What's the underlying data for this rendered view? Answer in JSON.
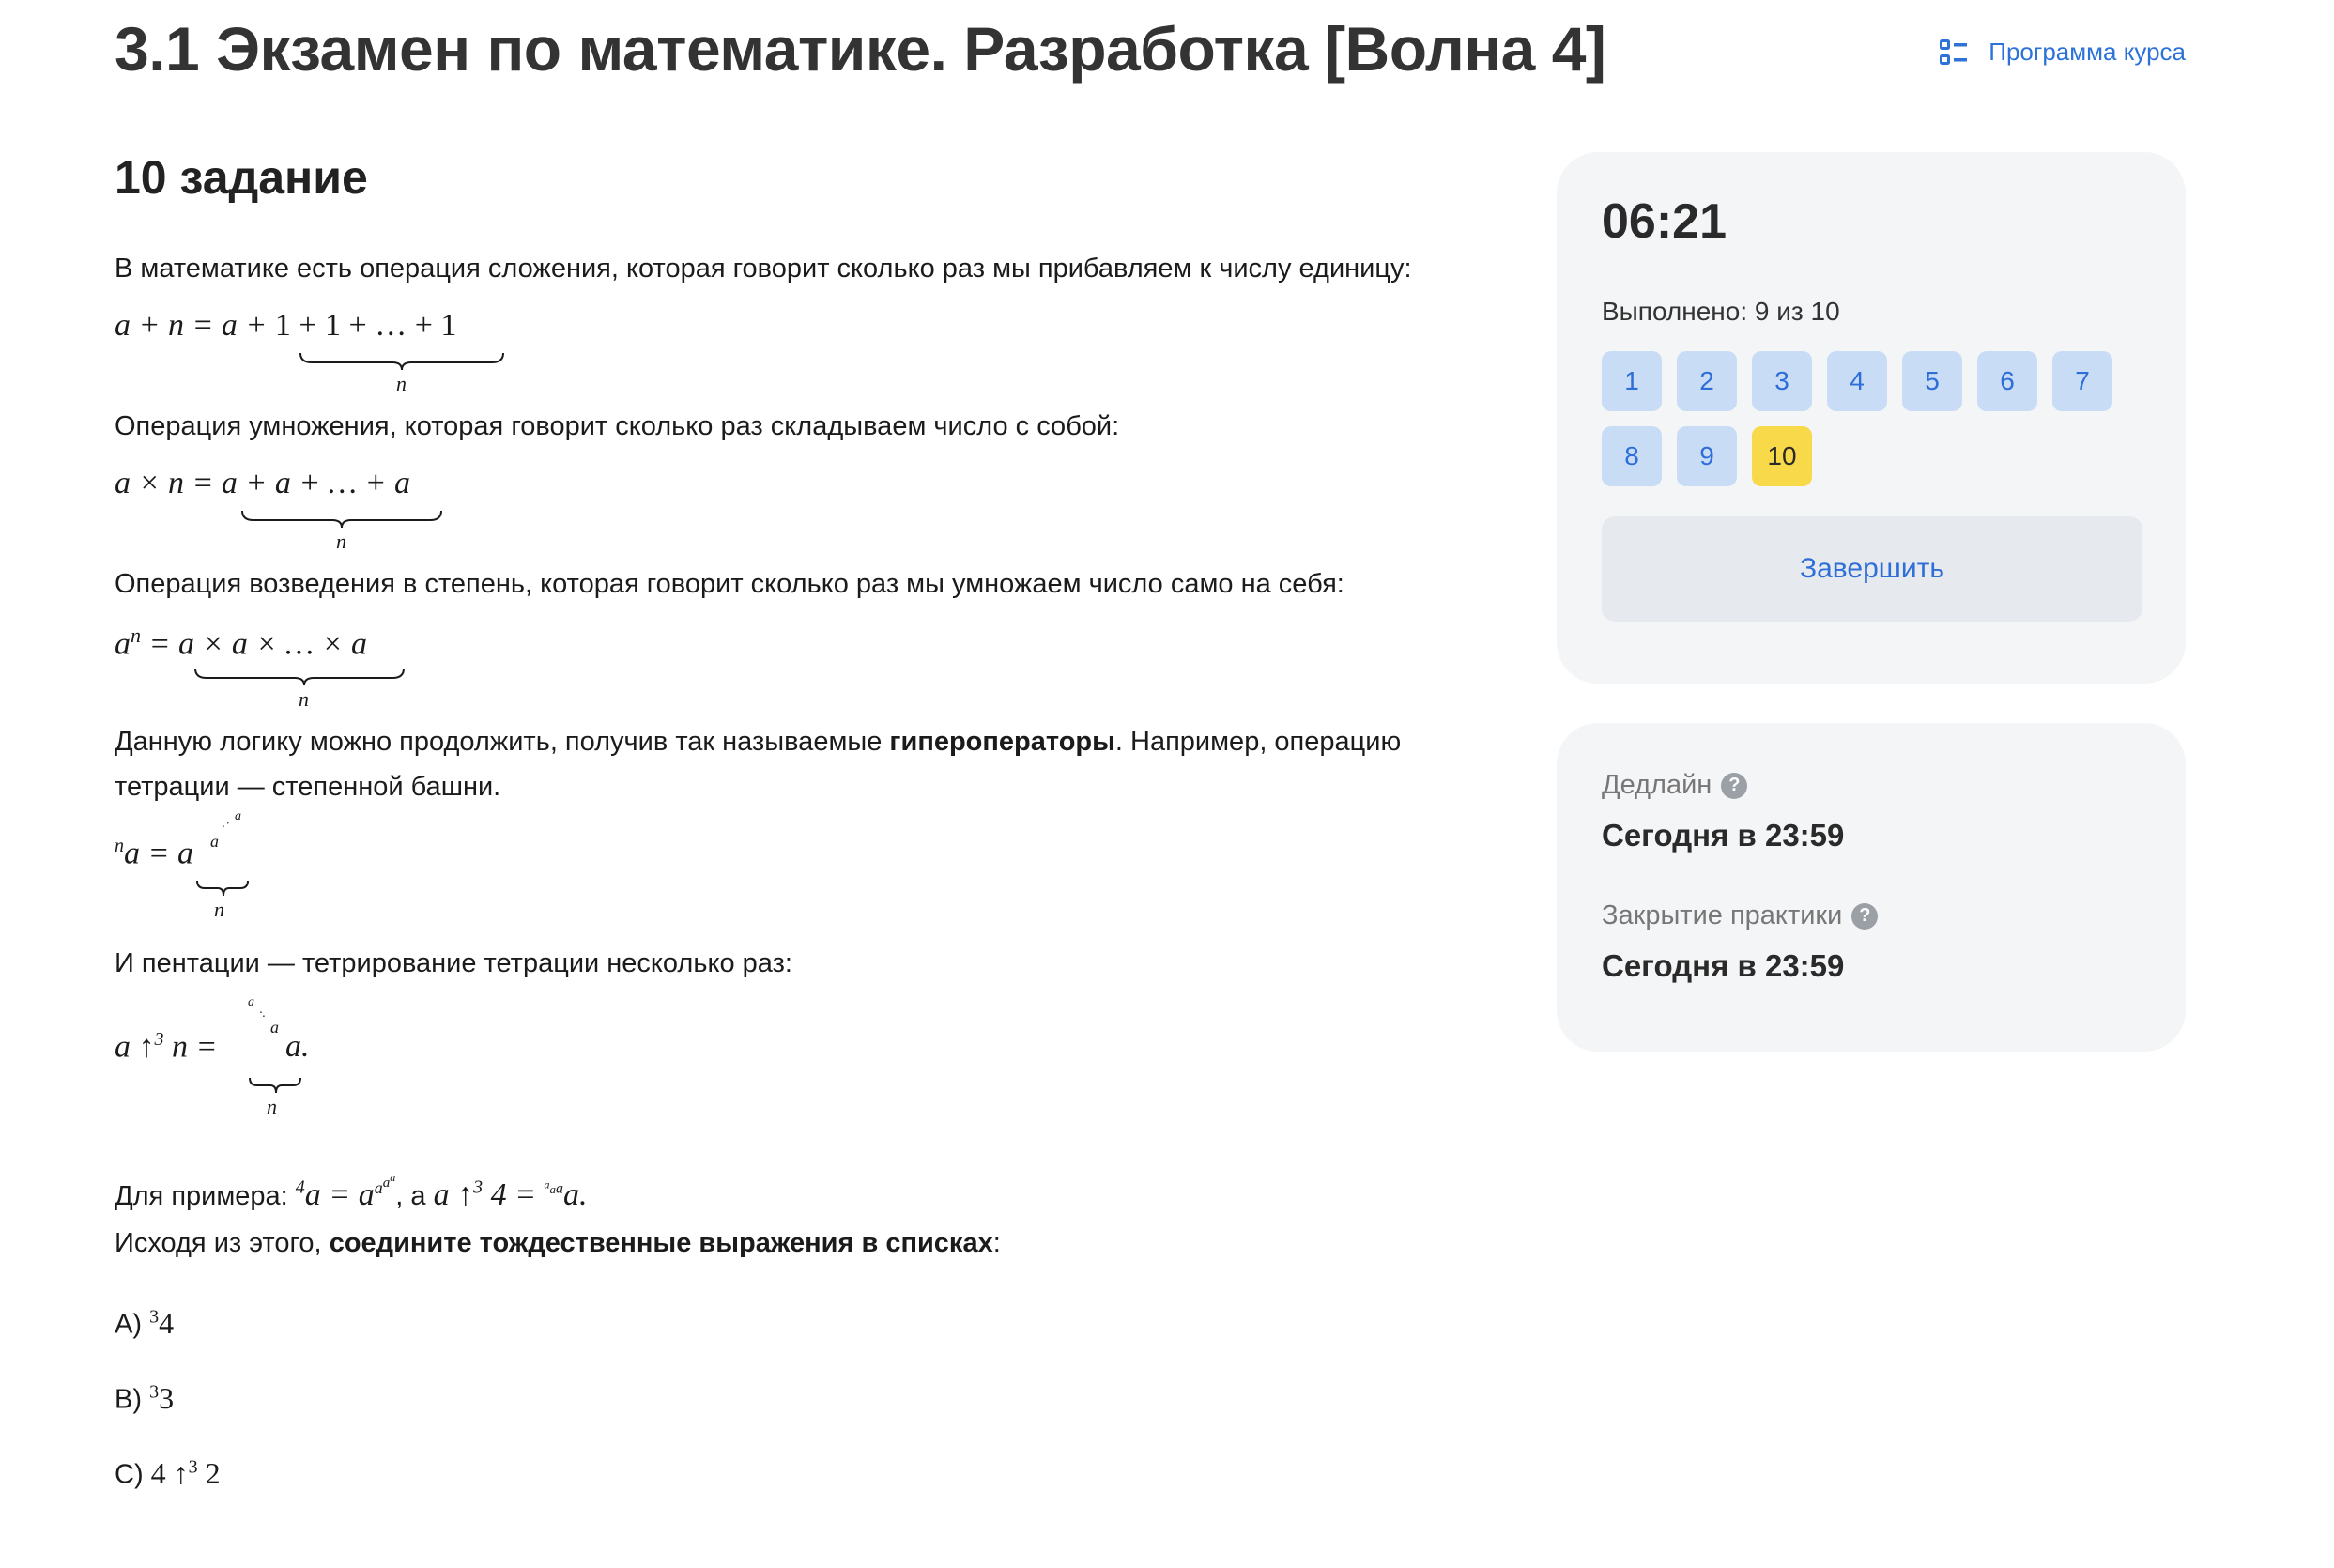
{
  "header": {
    "title": "3.1 Экзамен по математике. Разработка [Волна 4]",
    "program_link": "Программа курса"
  },
  "task": {
    "title": "10 задание",
    "p1": "В математике есть операция сложения, которая говорит сколько раз мы прибавляем к числу единицу:",
    "p2": "Операция умножения, которая говорит сколько раз складываем число с собой:",
    "p3": "Операция возведения в степень, которая говорит сколько раз мы умножаем число само на себя:",
    "p4_before": "Данную логику можно продолжить, получив так называемые ",
    "p4_bold": "гипероператоры",
    "p4_after": ". Например, операцию тетрации — степенной башни.",
    "p5": "И пентации — тетрирование тетрации несколько раз:",
    "example_prefix": "Для примера: ",
    "example_mid": ", а ",
    "p6_before": "Исходя из этого, ",
    "p6_bold": "соедините тождественные выражения в списках",
    "p6_after": ":",
    "answers": [
      {
        "label": "A)",
        "expr_sup": "3",
        "expr_base": "4"
      },
      {
        "label": "B)",
        "expr_sup": "3",
        "expr_base": "3"
      },
      {
        "label": "C)",
        "expr_left": "4 ↑",
        "expr_sup": "3",
        "expr_right": "2"
      }
    ]
  },
  "formulas": {
    "f1_lhs": "a + n = a + ",
    "f1_under": "1 + 1 + … + 1",
    "f1_brace": "n",
    "f2_lhs": "a × n = ",
    "f2_under": "a + a + … + a",
    "f2_brace": "n",
    "f3_lhs_base": "a",
    "f3_lhs_sup": "n",
    "f3_eq": " = ",
    "f3_under": "a × a × … × a",
    "f3_brace": "n",
    "f4_pre": "n",
    "f4_lhs": "a = ",
    "f4_tower_base": "a",
    "f4_tower_1": "a",
    "f4_tower_dots": "·˙",
    "f4_tower_top": "a",
    "f4_brace": "n",
    "f5_lhs": "a ↑",
    "f5_sup": "3",
    "f5_mid": " n = ",
    "f5_tower_base": "a.",
    "f5_tower_1": "a",
    "f5_tower_dots": "·.",
    "f5_tower_top": "a",
    "f5_brace": "n",
    "ex1_pre": "4",
    "ex1": "a = a",
    "ex1_t1": "a",
    "ex1_t2": "a",
    "ex1_t3": "a",
    "ex2_lhs": "a ↑",
    "ex2_sup": "3",
    "ex2_mid": " 4 = ",
    "ex2_t1": "a",
    "ex2_t2": "a",
    "ex2_t3": "a",
    "ex2_base": "a."
  },
  "sidebar": {
    "timer": "06:21",
    "done_text": "Выполнено: 9 из 10",
    "questions": [
      "1",
      "2",
      "3",
      "4",
      "5",
      "6",
      "7",
      "8",
      "9",
      "10"
    ],
    "current_question": "10",
    "finish_button": "Завершить",
    "deadline_label": "Дедлайн",
    "deadline_value": "Сегодня в 23:59",
    "closing_label": "Закрытие практики",
    "closing_value": "Сегодня в 23:59",
    "help_icon": "?"
  },
  "colors": {
    "accent": "#2d72d9",
    "current_question": "#f7d94a",
    "question_bg": "#c9dcf5",
    "card_bg": "#f4f5f7"
  },
  "icons": {
    "program": "list-checklist-icon",
    "help": "question-circle-icon"
  }
}
